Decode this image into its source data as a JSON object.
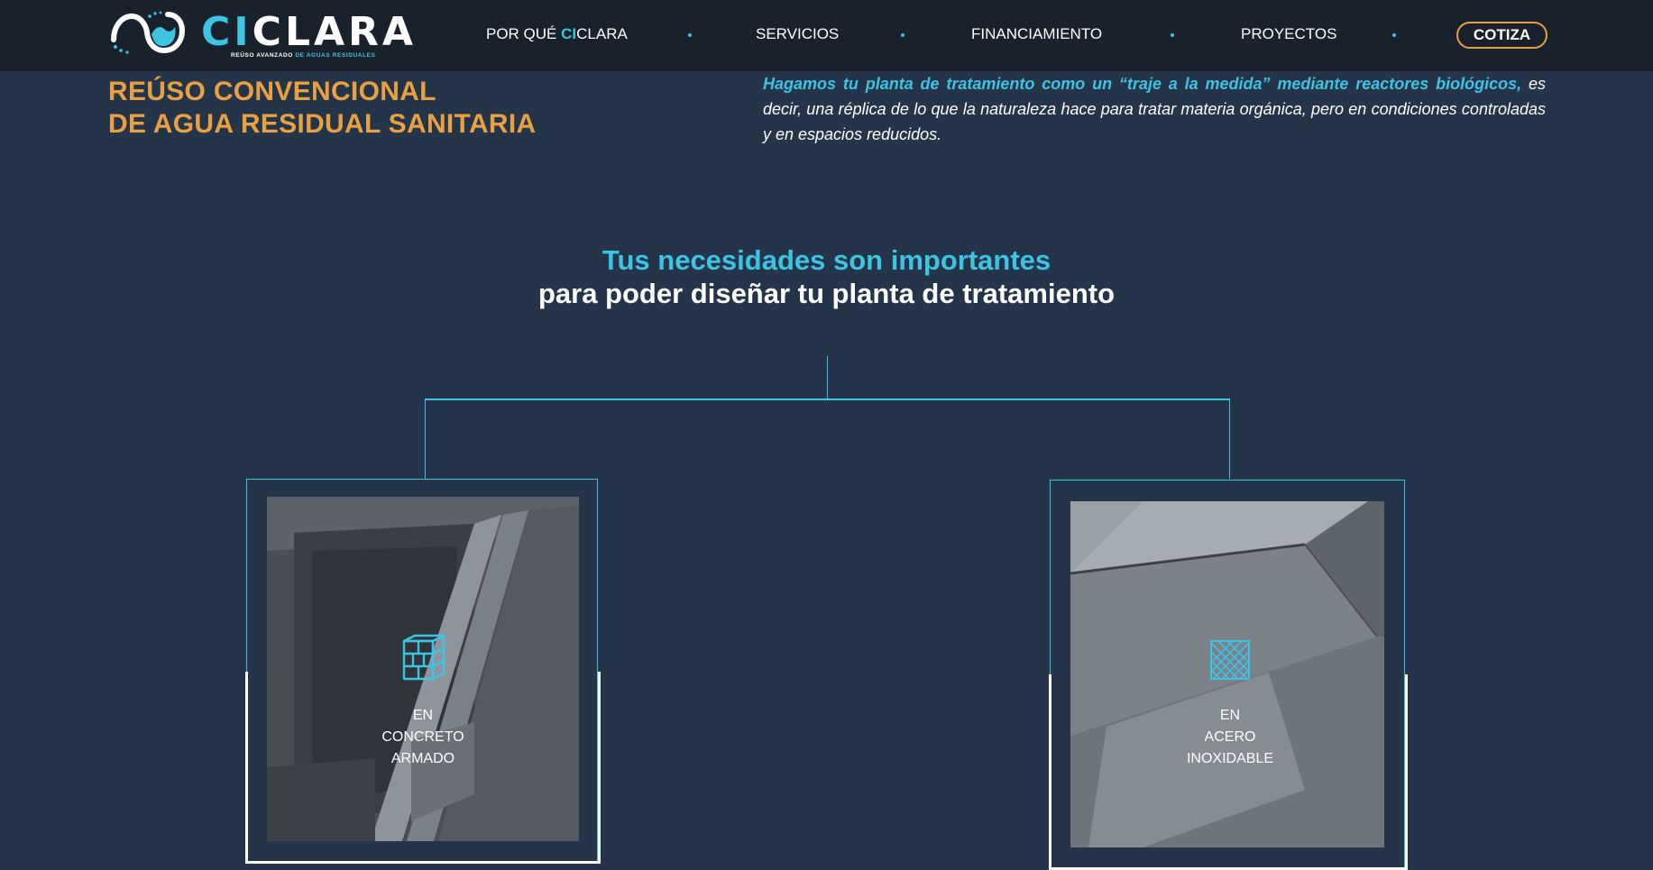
{
  "brand": {
    "name_prefix": "CI",
    "name_suffix": "CLARA",
    "tagline_main": "REÚSO AVANZADO",
    "tagline_accent": "DE AGUAS RESIDUALES",
    "logo_icon": "waves-logo-icon"
  },
  "nav": {
    "items": [
      {
        "pre": "POR QUÉ ",
        "hl": "CI",
        "post": "CLARA"
      },
      {
        "pre": "SERVICIOS",
        "hl": "",
        "post": ""
      },
      {
        "pre": "FINANCIAMIENTO",
        "hl": "",
        "post": ""
      },
      {
        "pre": "PROYECTOS",
        "hl": "",
        "post": ""
      }
    ],
    "cta_label": "COTIZA"
  },
  "section": {
    "title_line1": "REÚSO CONVENCIONAL",
    "title_line2": "DE AGUA RESIDUAL SANITARIA",
    "intro_lead": "Hagamos tu planta de tratamiento como un “traje a la medida” mediante reactores biológicos,",
    "intro_rest": "es decir, una réplica de lo que la naturaleza hace para tratar materia orgánica, pero en condiciones controladas y en espacios reducidos."
  },
  "heading": {
    "line1": "Tus necesidades son importantes",
    "line2": "para poder diseñar tu planta de tratamiento"
  },
  "cards": [
    {
      "line1": "EN",
      "line2": "CONCRETO",
      "line3": "ARMADO",
      "icon": "brick-cube-icon"
    },
    {
      "line1": "EN",
      "line2": "ACERO",
      "line3": "INOXIDABLE",
      "icon": "steel-mesh-icon"
    }
  ],
  "colors": {
    "background": "#243549",
    "navbar": "#19212c",
    "accent_cyan": "#3ec3e3",
    "accent_orange": "#e8a043",
    "text": "#ffffff"
  }
}
